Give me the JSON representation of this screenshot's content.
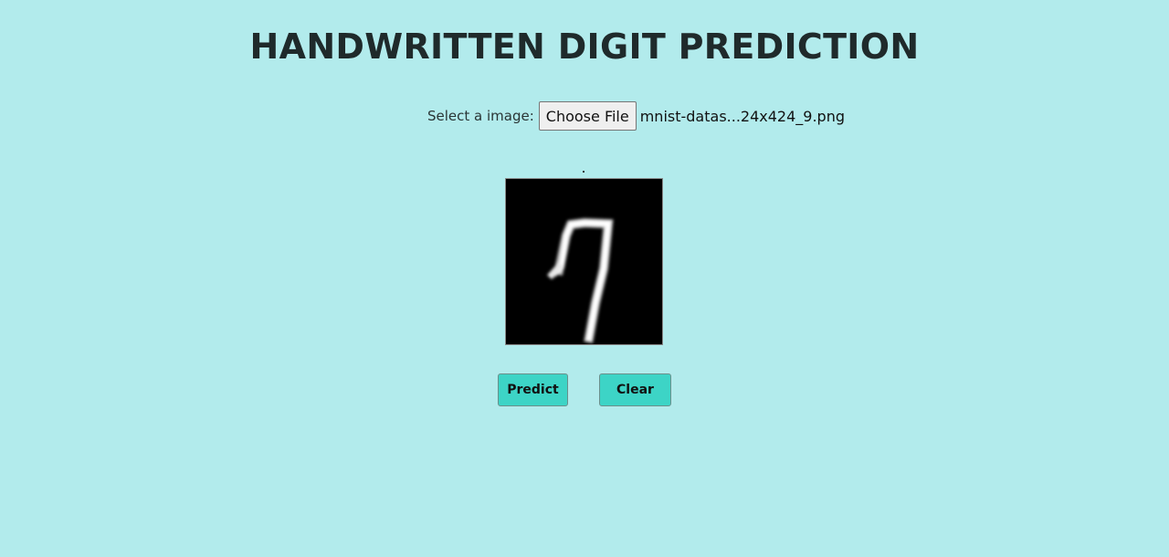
{
  "page": {
    "title": "HANDWRITTEN DIGIT PREDICTION"
  },
  "upload": {
    "label": "Select a image:",
    "button_label": "Choose File",
    "file_name": "mnist-datas...24x424_9.png"
  },
  "preview": {
    "icon": "handwritten-digit-image"
  },
  "actions": {
    "predict_label": "Predict",
    "clear_label": "Clear"
  },
  "colors": {
    "background": "#b2ebec",
    "button": "#3dd4c6",
    "title": "#1f2a2b"
  }
}
